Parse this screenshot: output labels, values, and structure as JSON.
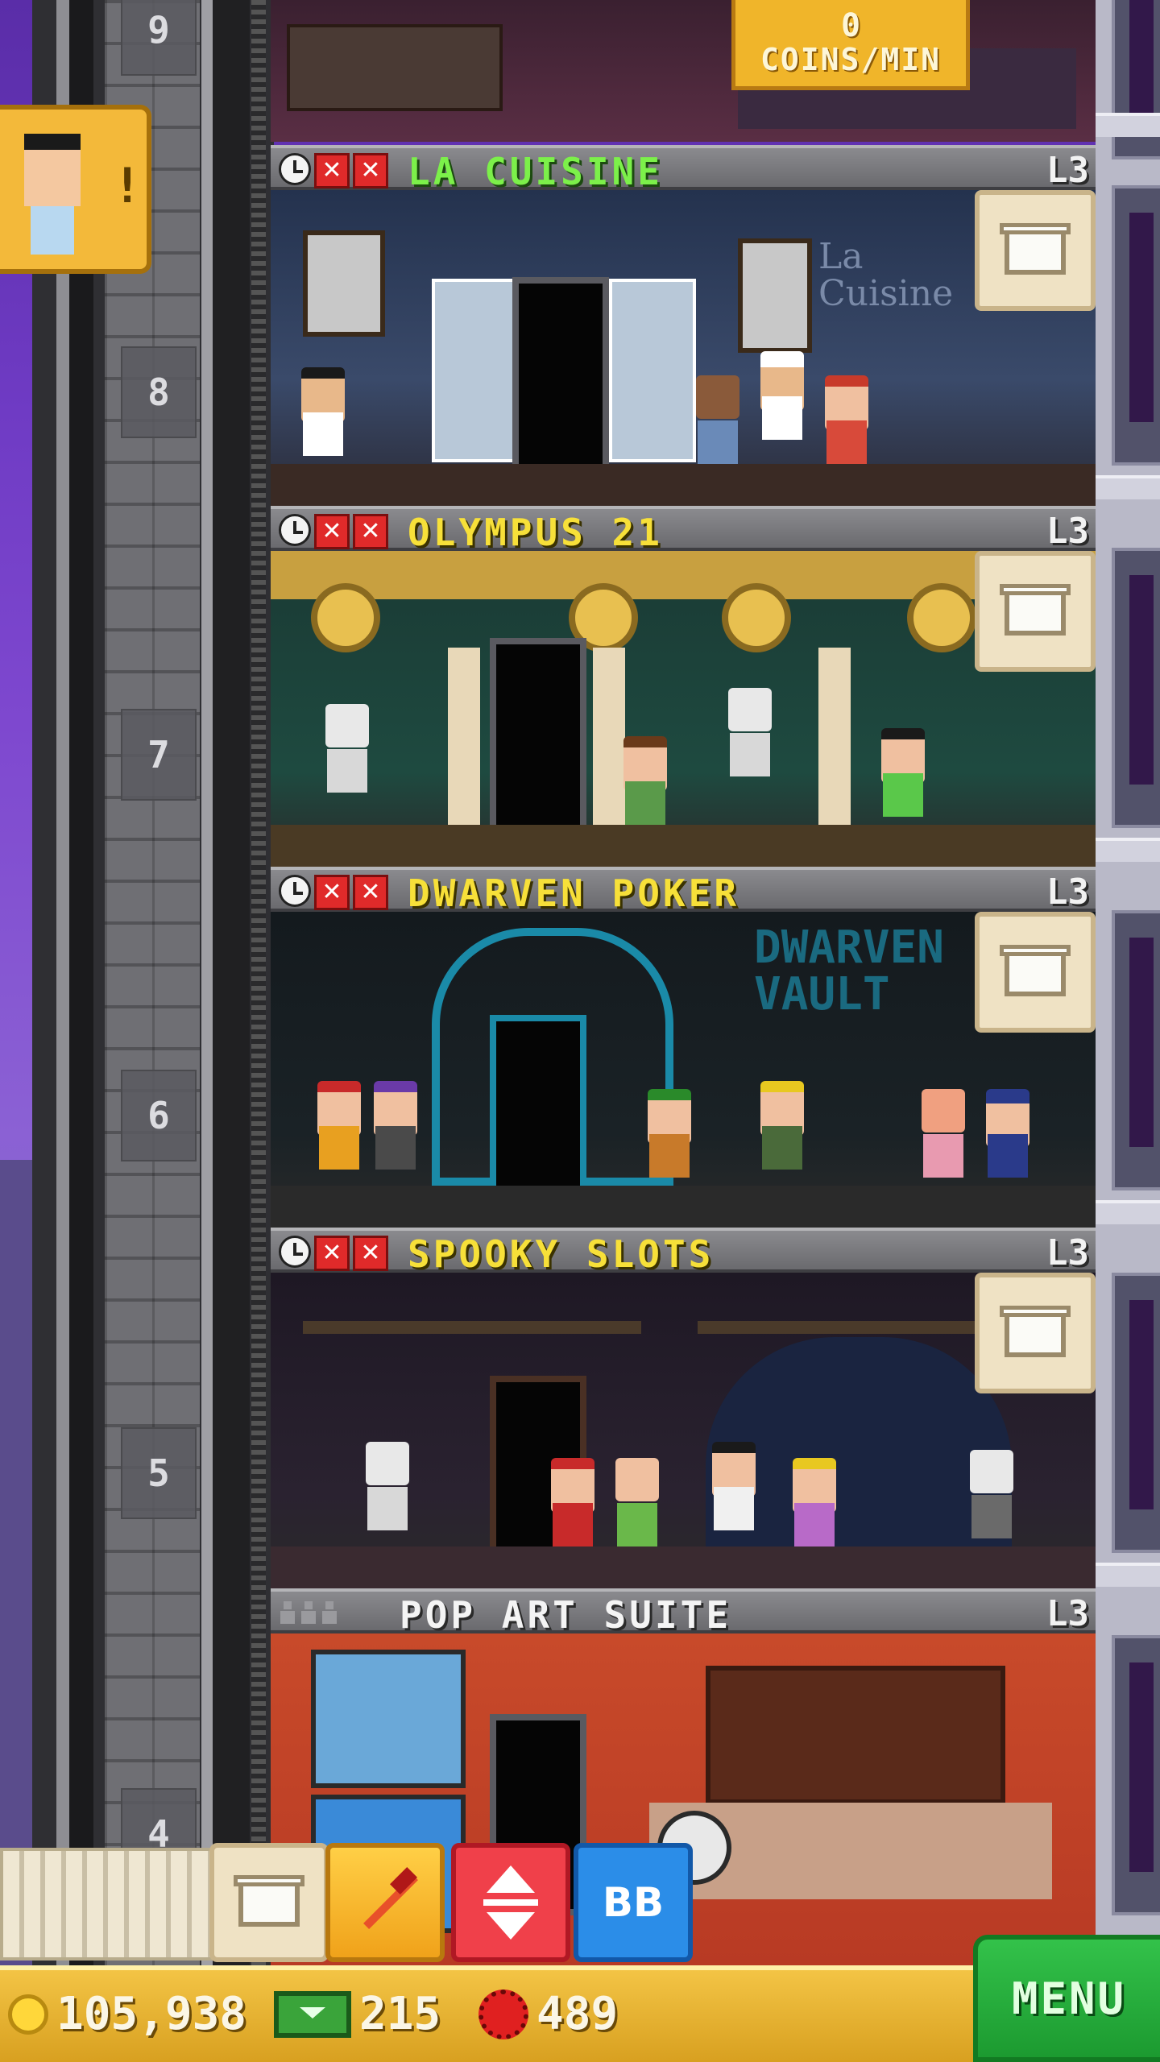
{
  "coins_per_min": {
    "value": "0",
    "label": "COINS/MIN"
  },
  "shaft_floor_numbers": [
    "9",
    "8",
    "7",
    "6",
    "5",
    "4"
  ],
  "floors": [
    {
      "name": "LA CUISINE",
      "level": "L3",
      "name_color": "green",
      "status": "stocking"
    },
    {
      "name": "OLYMPUS 21",
      "level": "L3",
      "name_color": "yellow",
      "status": "stocking"
    },
    {
      "name": "DWARVEN POKER",
      "level": "L3",
      "name_color": "yellow",
      "status": "stocking"
    },
    {
      "name": "SPOOKY SLOTS",
      "level": "L3",
      "name_color": "yellow",
      "status": "stocking"
    },
    {
      "name": "POP ART SUITE",
      "level": "L3",
      "name_color": "white",
      "status": "residential"
    }
  ],
  "room_signs": {
    "la_cuisine": "La Cuisine",
    "dwarven_poker": "DWARVEN VAULT"
  },
  "toolbar": {
    "bb_label": "BB"
  },
  "resources": {
    "coins": "105,938",
    "bux": "215",
    "tokens": "489"
  },
  "menu_label": "MENU",
  "colors": {
    "accent_gold": "#f0b52a",
    "menu_green": "#1c9a30",
    "alert_red": "#e02a2a",
    "bb_blue": "#2b8de8"
  }
}
